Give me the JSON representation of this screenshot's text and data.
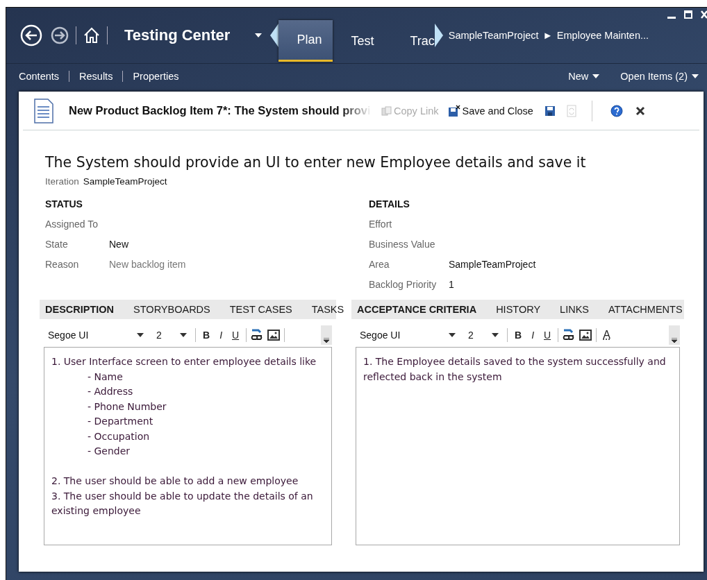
{
  "window": {
    "nav": {
      "back_enabled": true,
      "forward_enabled": false
    },
    "title": "Testing Center",
    "tabs": [
      {
        "label": "Plan",
        "selected": true
      },
      {
        "label": "Test",
        "selected": false
      },
      {
        "label": "Trac",
        "selected": false
      }
    ],
    "breadcrumb": {
      "items": [
        "SampleTeamProject",
        "Employee Mainten..."
      ],
      "separator": "►"
    }
  },
  "subnav": {
    "links": [
      "Contents",
      "Results",
      "Properties"
    ],
    "menus": [
      "New",
      "Open Items (2)"
    ]
  },
  "work_item": {
    "header_title": "New Product Backlog Item 7*: The System should provi",
    "toolbar": [
      {
        "kind": "copy",
        "label": "Copy Link",
        "disabled": true
      },
      {
        "kind": "save-close",
        "label": "Save and Close",
        "disabled": false
      },
      {
        "kind": "save",
        "disabled": false
      },
      {
        "kind": "refresh",
        "disabled": true
      },
      {
        "kind": "help",
        "disabled": false
      },
      {
        "kind": "close",
        "disabled": false
      }
    ],
    "title": "The System should provide an UI to enter new Employee details and save it",
    "iteration": {
      "label": "Iteration",
      "value": "SampleTeamProject"
    },
    "sections": [
      {
        "heading": "STATUS",
        "fields": [
          {
            "label": "Assigned To"
          },
          {
            "label": "State",
            "value": "New",
            "disabled": false
          },
          {
            "label": "Reason",
            "value": "New backlog item",
            "disabled": true
          }
        ]
      },
      {
        "heading": "DETAILS",
        "fields": [
          {
            "label": "Effort"
          },
          {
            "label": "Business Value"
          },
          {
            "label": "Area",
            "value": "SampleTeamProject",
            "disabled": false
          },
          {
            "label": "Backlog Priority",
            "value": "1",
            "disabled": false
          }
        ]
      }
    ],
    "panes": [
      {
        "tabs": [
          {
            "label": "DESCRIPTION",
            "selected": true
          },
          {
            "label": "STORYBOARDS",
            "selected": false
          },
          {
            "label": "TEST CASES",
            "selected": false
          },
          {
            "label": "TASKS",
            "selected": false
          }
        ],
        "toolbar": {
          "font": "Segoe UI",
          "size": "2",
          "items": [
            {
              "kind": "format",
              "label": "B"
            },
            {
              "kind": "format",
              "label": "I"
            },
            {
              "kind": "format",
              "label": "U"
            },
            {
              "kind": "link"
            },
            {
              "kind": "picture"
            }
          ]
        },
        "content": [
          {
            "text": "1. User Interface screen to enter employee details like",
            "subitems": [
              "- Name",
              "- Address",
              "- Phone Number",
              "- Department",
              "- Occupation",
              "- Gender"
            ]
          },
          {
            "text": "2. The user should be able to add a new employee"
          },
          {
            "text": "3. The user should be able to update the details of an existing employee"
          }
        ]
      },
      {
        "tabs": [
          {
            "label": "ACCEPTANCE CRITERIA",
            "selected": true
          },
          {
            "label": "HISTORY",
            "selected": false
          },
          {
            "label": "LINKS",
            "selected": false
          },
          {
            "label": "ATTACHMENTS",
            "selected": false
          }
        ],
        "toolbar": {
          "font": "Segoe UI",
          "size": "2",
          "items": [
            {
              "kind": "format",
              "label": "B"
            },
            {
              "kind": "format",
              "label": "I"
            },
            {
              "kind": "format",
              "label": "U"
            },
            {
              "kind": "link"
            },
            {
              "kind": "picture"
            },
            {
              "kind": "color",
              "label": "A"
            }
          ]
        },
        "content": [
          {
            "text": "1. The Employee details saved to the system successfully and reflected back in the system"
          }
        ]
      }
    ]
  }
}
